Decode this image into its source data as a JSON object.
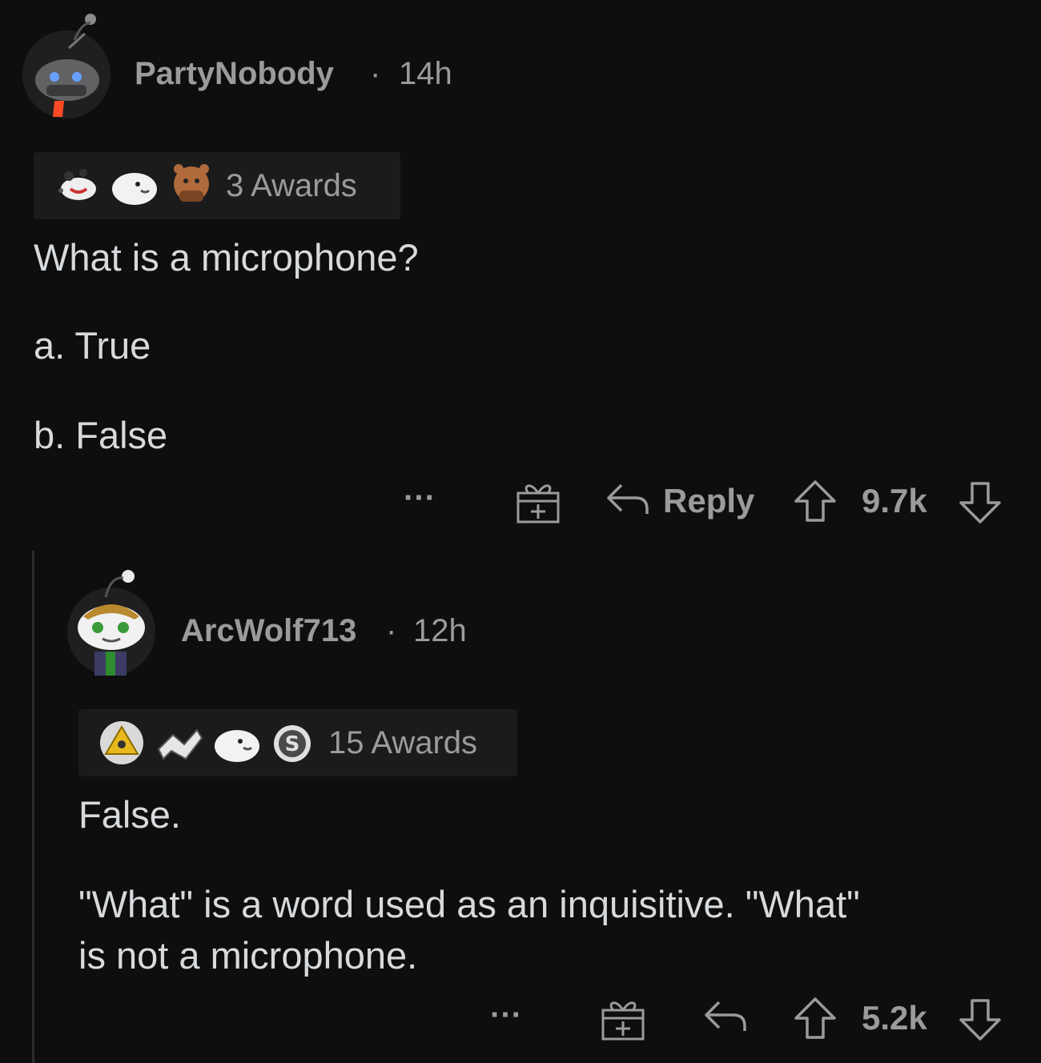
{
  "comments": [
    {
      "username": "PartyNobody",
      "separator": "·",
      "time": "14h",
      "awards_label": "3 Awards",
      "award_icons": [
        "wholesome-seal-icon",
        "seal-icon",
        "bear-award-icon"
      ],
      "body": [
        "What is a microphone?",
        "a. True",
        "b. False"
      ],
      "actions": {
        "more": "···",
        "reply": "Reply",
        "score": "9.7k"
      }
    },
    {
      "username": "ArcWolf713",
      "separator": "·",
      "time": "12h",
      "awards_label": "15 Awards",
      "award_icons": [
        "illuminati-award-icon",
        "handshake-award-icon",
        "seal-icon",
        "silver-award-icon"
      ],
      "body": [
        "False.",
        "\"What\" is a word used as an inquisitive. \"What\"",
        "is not a microphone."
      ],
      "actions": {
        "more": "···",
        "score": "5.2k"
      }
    }
  ],
  "colors": {
    "background": "#0e0e0f",
    "text": "#d7dadc",
    "muted": "#9a9b9c",
    "award_box": "#1b1b1c"
  }
}
